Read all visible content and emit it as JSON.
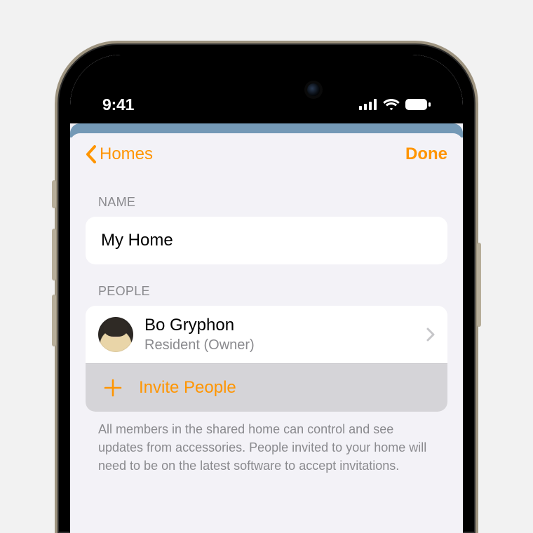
{
  "status": {
    "time": "9:41"
  },
  "nav": {
    "back_label": "Homes",
    "done_label": "Done"
  },
  "sections": {
    "name_header": "NAME",
    "people_header": "PEOPLE"
  },
  "home": {
    "name": "My Home"
  },
  "people": [
    {
      "name": "Bo Gryphon",
      "role": "Resident (Owner)"
    }
  ],
  "actions": {
    "invite_label": "Invite People"
  },
  "footer": {
    "note": "All members in the shared home can control and see updates from accessories. People invited to your home will need to be on the latest software to accept invitations."
  },
  "colors": {
    "accent": "#ff9500"
  }
}
